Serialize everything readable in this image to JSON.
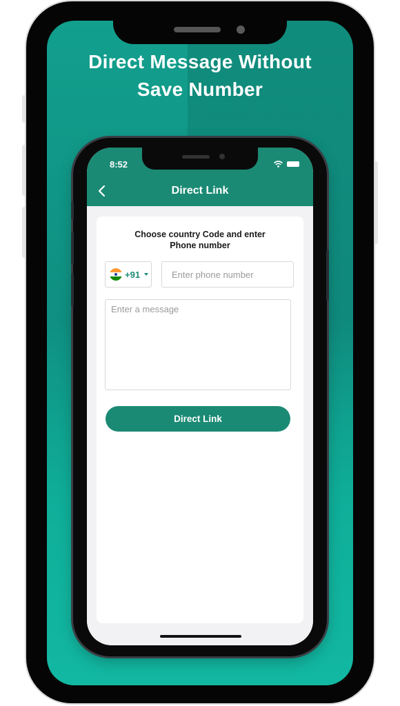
{
  "promo": {
    "headline_line1": "Direct Message Without",
    "headline_line2": "Save Number"
  },
  "status_bar": {
    "time": "8:52"
  },
  "header": {
    "title": "Direct Link",
    "back_icon": "chevron-left-icon"
  },
  "form": {
    "title_line1": "Choose country Code and enter",
    "title_line2": "Phone number",
    "country": {
      "flag_icon": "india-flag-icon",
      "dial_code": "+91"
    },
    "phone_placeholder": "Enter phone number",
    "message_placeholder": "Enter a message",
    "submit_label": "Direct Link"
  },
  "colors": {
    "brand": "#1b8a74",
    "promo_background": "#119d8b"
  }
}
